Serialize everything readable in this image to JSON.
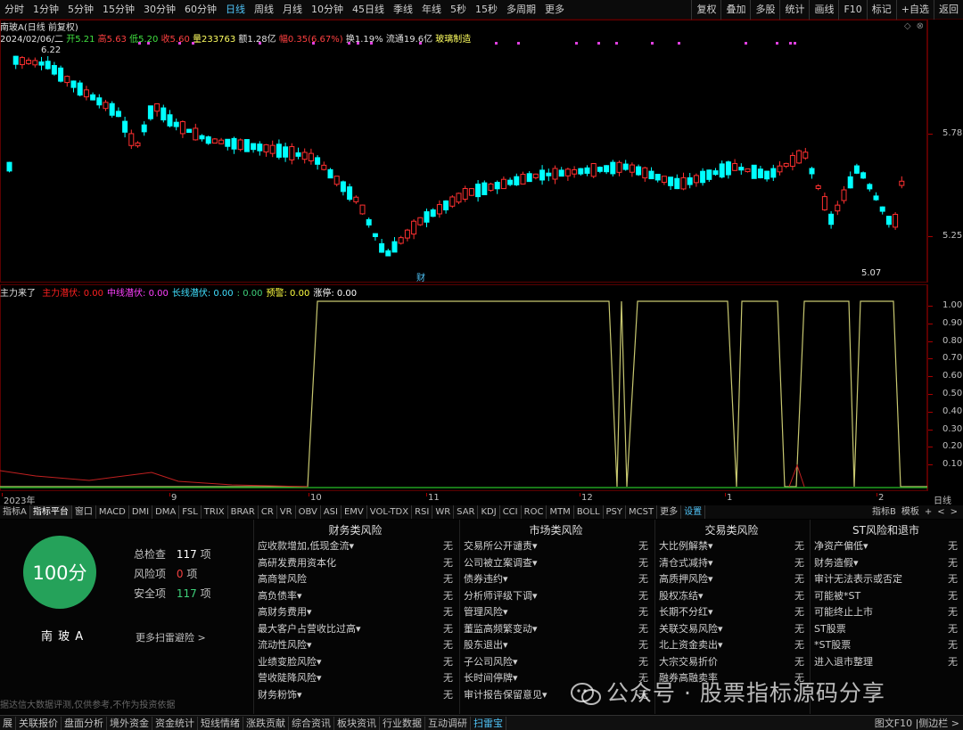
{
  "toolbar": {
    "periods": [
      "分时",
      "1分钟",
      "5分钟",
      "15分钟",
      "30分钟",
      "60分钟",
      "日线",
      "周线",
      "月线",
      "10分钟",
      "45日线",
      "季线",
      "年线",
      "5秒",
      "15秒",
      "多周期",
      "更多"
    ],
    "active_period": "日线",
    "right_buttons": [
      "复权",
      "叠加",
      "多股",
      "统计",
      "画线",
      "F10",
      "标记",
      "+自选",
      "返回"
    ]
  },
  "quote": {
    "name": "南玻A(日线 前复权)",
    "date": "2024/02/06/二",
    "open": "开5.21",
    "high": "高5.63",
    "low": "低5.20",
    "close": "收5.60",
    "volume": "量233763",
    "amount": "额1.28亿",
    "change": "幅0.35(6.67%)",
    "turnover": "换1.19%",
    "float": "流通19.6亿",
    "sector": "玻璃制造"
  },
  "chart_marks": {
    "price_high_label": "6.22",
    "price_low_label": "5.07",
    "finance_mark": "财"
  },
  "price_axis": [
    "5.78",
    "5.25"
  ],
  "indicator": {
    "name": "主力来了",
    "items": [
      {
        "label": "主力潜伏: 0.00",
        "color": "#ff2020"
      },
      {
        "label": "中线潜伏: 0.00",
        "color": "#ff40ff"
      },
      {
        "label": "长线潜伏: 0.00",
        "color": "#40e0ff"
      },
      {
        "label": ": 0.00",
        "color": "#3ed07a"
      },
      {
        "label": "预警: 0.00",
        "color": "#ffff40"
      },
      {
        "label": "涨停: 0.00",
        "color": "#ffffff"
      }
    ],
    "axis": [
      "1.00",
      "0.90",
      "0.80",
      "0.70",
      "0.60",
      "0.50",
      "0.40",
      "0.30",
      "0.20",
      "0.10"
    ]
  },
  "date_axis": {
    "labels": [
      "2023年",
      "9",
      "10",
      "11",
      "12",
      "1",
      "2"
    ],
    "right": "日线"
  },
  "indicator_tabs": [
    "指标A",
    "指标平台",
    "窗口",
    "MACD",
    "DMI",
    "DMA",
    "FSL",
    "TRIX",
    "BRAR",
    "CR",
    "VR",
    "OBV",
    "ASI",
    "EMV",
    "VOL-TDX",
    "RSI",
    "WR",
    "SAR",
    "KDJ",
    "CCI",
    "ROC",
    "MTM",
    "BOLL",
    "PSY",
    "MCST",
    "更多",
    "设置"
  ],
  "indicator_tabs_right": [
    "指标B",
    "模板",
    "+",
    "<",
    ">"
  ],
  "scan": {
    "score": "100分",
    "total_label": "总检查",
    "total_value": "117",
    "risk_label": "风险项",
    "risk_value": "0",
    "safe_label": "安全项",
    "safe_value": "117",
    "unit": "项",
    "stock_name": "南 玻 A",
    "more_link": "更多扫雷避险 >",
    "disclaimer": "据达信大数据评测,仅供参考,不作为投资依据",
    "columns": [
      {
        "title": "财务类风险",
        "items": [
          {
            "label": "应收款增加,低现金流▾",
            "value": "无"
          },
          {
            "label": "高研发费用资本化",
            "value": "无"
          },
          {
            "label": "高商誉风险",
            "value": "无"
          },
          {
            "label": "高负债率▾",
            "value": "无"
          },
          {
            "label": "高财务费用▾",
            "value": "无"
          },
          {
            "label": "最大客户占营收比过高▾",
            "value": "无"
          },
          {
            "label": "流动性风险▾",
            "value": "无"
          },
          {
            "label": "业绩变脸风险▾",
            "value": "无"
          },
          {
            "label": "营收陡降风险▾",
            "value": "无"
          },
          {
            "label": "财务粉饰▾",
            "value": "无"
          }
        ]
      },
      {
        "title": "市场类风险",
        "items": [
          {
            "label": "交易所公开谴责▾",
            "value": "无"
          },
          {
            "label": "公司被立案调查▾",
            "value": "无"
          },
          {
            "label": "债券违约▾",
            "value": "无"
          },
          {
            "label": "分析师评级下调▾",
            "value": "无"
          },
          {
            "label": "管理风险▾",
            "value": "无"
          },
          {
            "label": "董监高频繁变动▾",
            "value": "无"
          },
          {
            "label": "股东退出▾",
            "value": "无"
          },
          {
            "label": "子公司风险▾",
            "value": "无"
          },
          {
            "label": "长时间停牌▾",
            "value": "无"
          },
          {
            "label": "审计报告保留意见▾",
            "value": "无"
          }
        ]
      },
      {
        "title": "交易类风险",
        "items": [
          {
            "label": "大比例解禁▾",
            "value": "无"
          },
          {
            "label": "清仓式减持▾",
            "value": "无"
          },
          {
            "label": "高质押风险▾",
            "value": "无"
          },
          {
            "label": "股权冻结▾",
            "value": "无"
          },
          {
            "label": "长期不分红▾",
            "value": "无"
          },
          {
            "label": "关联交易风险▾",
            "value": "无"
          },
          {
            "label": "北上资金卖出▾",
            "value": "无"
          },
          {
            "label": "大宗交易折价",
            "value": "无"
          },
          {
            "label": "融券高融卖率",
            "value": "无"
          }
        ]
      },
      {
        "title": "ST风险和退市",
        "items": [
          {
            "label": "净资产偏低▾",
            "value": "无"
          },
          {
            "label": "财务造假▾",
            "value": "无"
          },
          {
            "label": "审计无法表示或否定",
            "value": "无"
          },
          {
            "label": "可能被*ST",
            "value": "无"
          },
          {
            "label": "可能终止上市",
            "value": "无"
          },
          {
            "label": "ST股票",
            "value": "无"
          },
          {
            "label": "*ST股票",
            "value": "无"
          },
          {
            "label": "进入退市整理",
            "value": "无"
          }
        ]
      }
    ]
  },
  "bottom_tabs": [
    "展",
    "关联报价",
    "盘面分析",
    "境外资金",
    "资金统计",
    "短线情绪",
    "涨跌贡献",
    "综合资讯",
    "板块资讯",
    "行业数据",
    "互动调研",
    "扫雷宝"
  ],
  "bottom_active": "扫雷宝",
  "bottom_right": "图文F10 |侧边栏 >",
  "watermark": "公众号 · 股票指标源码分享",
  "colors": {
    "up": "#ff3030",
    "down": "#00ffff",
    "line_yellow": "#c8c870",
    "line_green": "#20a020",
    "border": "#5a0000",
    "accent": "#4fc3f7",
    "score_green": "#25a25a"
  }
}
